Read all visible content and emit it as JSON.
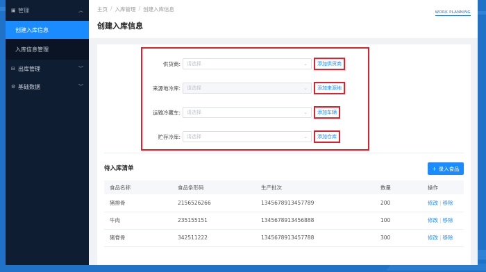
{
  "sidebar": {
    "items": [
      {
        "label": "管理",
        "icon": "inbox-icon"
      },
      {
        "label": "创建入库信息"
      },
      {
        "label": "入库信息管理"
      },
      {
        "label": "出库管理",
        "icon": "outbox-icon"
      },
      {
        "label": "基础数据",
        "icon": "settings-icon"
      }
    ]
  },
  "breadcrumb": [
    "主页",
    "入库管理",
    "创建入库信息"
  ],
  "page_title": "创建入库信息",
  "brand": "WORK PLANNING",
  "form": {
    "rows": [
      {
        "label": "供货商:",
        "placeholder": "请选择",
        "add_label": "添加供货商"
      },
      {
        "label": "来源地冷库:",
        "placeholder": "请选择",
        "add_label": "添加来源地"
      },
      {
        "label": "运输冷藏车:",
        "placeholder": "请选择",
        "add_label": "添加车辆"
      },
      {
        "label": "贮存冷库:",
        "placeholder": "请选择",
        "add_label": "添加仓库"
      }
    ]
  },
  "list": {
    "title": "待入库清单",
    "add_button": "录入食品",
    "columns": [
      "食品名称",
      "食品条形码",
      "生产批次",
      "数量",
      "操作"
    ],
    "rows": [
      {
        "name": "猪排骨",
        "barcode": "2156526266",
        "batch": "1345678913457789",
        "qty": "200",
        "edit": "修改",
        "remove": "移除"
      },
      {
        "name": "牛肉",
        "barcode": "235155151",
        "batch": "1345678913456888",
        "qty": "100",
        "edit": "修改",
        "remove": "移除"
      },
      {
        "name": "猪脊骨",
        "barcode": "342511222",
        "batch": "1345678913457788",
        "qty": "300",
        "edit": "修改",
        "remove": "移除"
      }
    ]
  }
}
